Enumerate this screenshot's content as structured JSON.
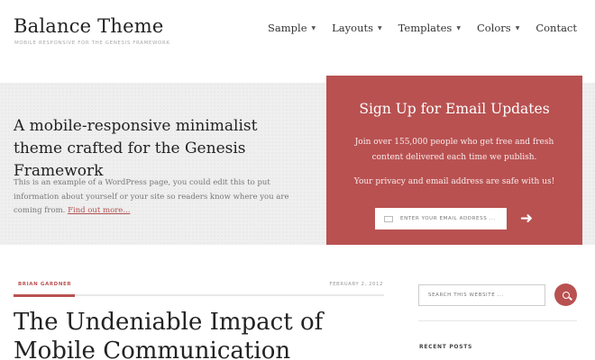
{
  "header": {
    "site_title": "Balance Theme",
    "site_description": "Mobile Responsive for the Genesis Framework",
    "nav": [
      {
        "label": "Sample",
        "has_dropdown": true
      },
      {
        "label": "Layouts",
        "has_dropdown": true
      },
      {
        "label": "Templates",
        "has_dropdown": true
      },
      {
        "label": "Colors",
        "has_dropdown": true
      },
      {
        "label": "Contact",
        "has_dropdown": false
      }
    ]
  },
  "hero": {
    "heading": "A mobile-responsive minimalist theme crafted for the Genesis Framework",
    "text": "This is an example of a WordPress page, you could edit this to put information about yourself or your site so readers know where you are coming from.",
    "link_text": "Find out more..."
  },
  "signup": {
    "title": "Sign Up for Email Updates",
    "text": "Join over 155,000 people who get free and fresh content delivered each time we publish.",
    "privacy": "Your privacy and email address are safe with us!",
    "email_placeholder": "Enter your email address ...",
    "submit_icon": "arrow-right-icon"
  },
  "post": {
    "author": "Brian Gardner",
    "date": "February 2, 2012",
    "title": "The Undeniable Impact of Mobile Communication"
  },
  "sidebar": {
    "search_placeholder": "SEARCH THIS WEBSITE ...",
    "search_icon": "search-icon",
    "recent_posts_heading": "Recent Posts"
  },
  "colors": {
    "accent": "#b95151",
    "hero_background": "#efefef"
  }
}
